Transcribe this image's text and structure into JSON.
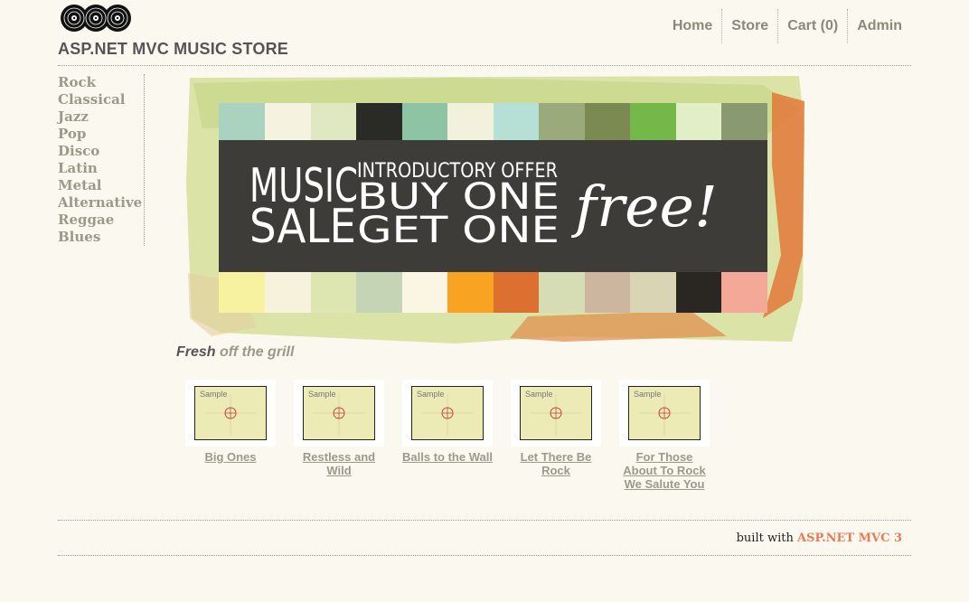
{
  "header": {
    "title": "ASP.NET MVC MUSIC STORE",
    "nav": [
      {
        "label": "Home"
      },
      {
        "label": "Store"
      },
      {
        "label": "Cart (0)"
      },
      {
        "label": "Admin"
      }
    ]
  },
  "genres": [
    "Rock",
    "Classical",
    "Jazz",
    "Pop",
    "Disco",
    "Latin",
    "Metal",
    "Alternative",
    "Reggae",
    "Blues"
  ],
  "banner": {
    "line1": "MUSIC",
    "line2": "SALE",
    "offer": "INTRODUCTORY OFFER",
    "buy": "BUY ONE",
    "get": "GET ONE",
    "free": "free!"
  },
  "fresh": {
    "strong": "Fresh",
    "rest": " off the grill"
  },
  "albums": [
    {
      "title": "Big Ones",
      "art": "Sample"
    },
    {
      "title": "Restless and Wild",
      "art": "Sample"
    },
    {
      "title": "Balls to the Wall",
      "art": "Sample"
    },
    {
      "title": "Let There Be Rock",
      "art": "Sample"
    },
    {
      "title": "For Those About To Rock We Salute You",
      "art": "Sample"
    }
  ],
  "footer": {
    "prefix": "built with ",
    "link": "ASP.NET MVC 3"
  },
  "colors": {
    "background": "#fbf8f0",
    "accent": "#e87a55",
    "nav": "#8a8a7a"
  }
}
